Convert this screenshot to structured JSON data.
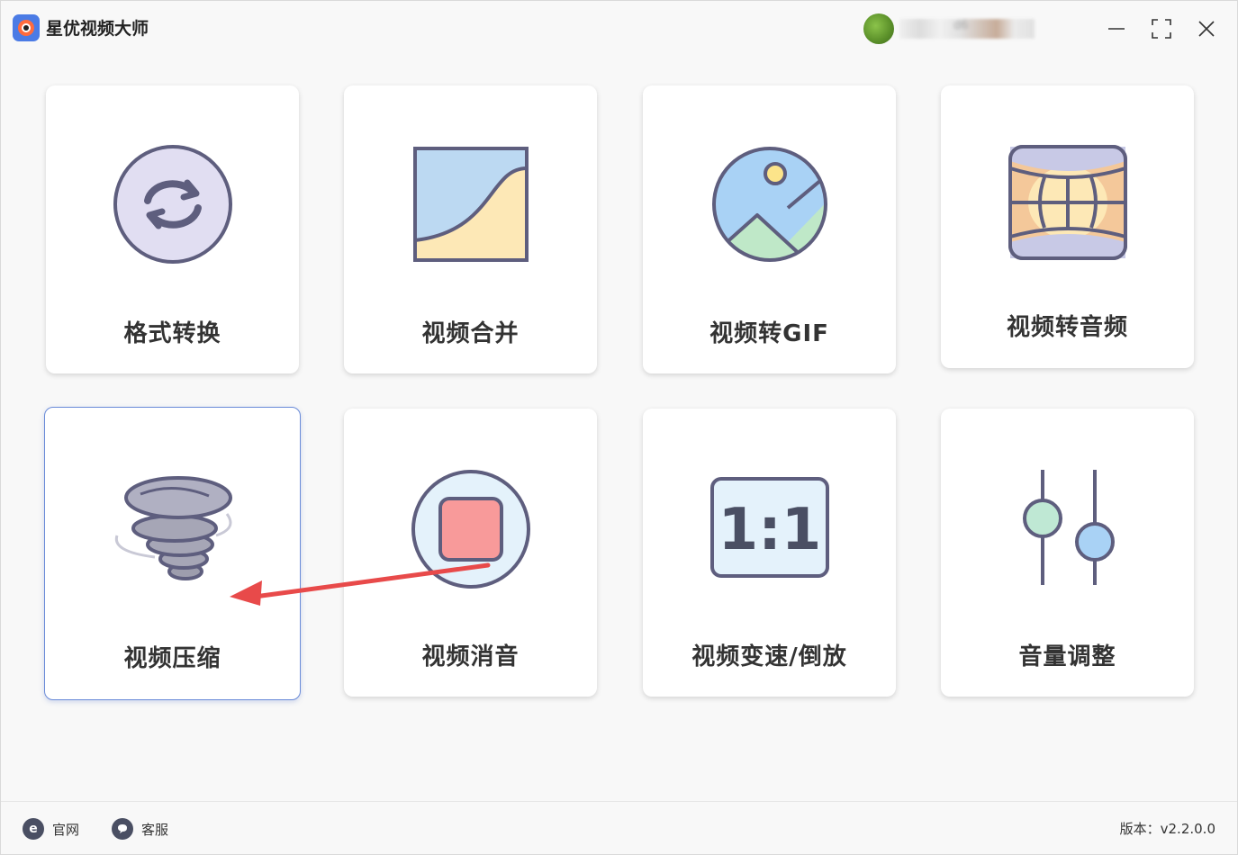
{
  "app": {
    "title": "星优视频大师",
    "user_name_blurred": "d6"
  },
  "cards": [
    {
      "label": "格式转换",
      "icon": "convert-icon"
    },
    {
      "label": "视频合并",
      "icon": "merge-icon"
    },
    {
      "label": "视频转GIF",
      "icon": "image-gif-icon"
    },
    {
      "label": "视频转音频",
      "icon": "audio-icon"
    },
    {
      "label": "视频压缩",
      "icon": "tornado-compress-icon",
      "selected": true
    },
    {
      "label": "视频消音",
      "icon": "stop-mute-icon"
    },
    {
      "label": "视频变速/倒放",
      "icon": "ratio-1-1-icon",
      "icon_text": "1:1"
    },
    {
      "label": "音量调整",
      "icon": "sliders-icon"
    }
  ],
  "footer": {
    "website_label": "官网",
    "website_icon_glyph": "e",
    "service_label": "客服",
    "version": "版本：v2.2.0.0"
  },
  "colors": {
    "outline": "#5e5e7e",
    "selected_border": "#6a8bd8",
    "arrow": "#e84a4a"
  }
}
